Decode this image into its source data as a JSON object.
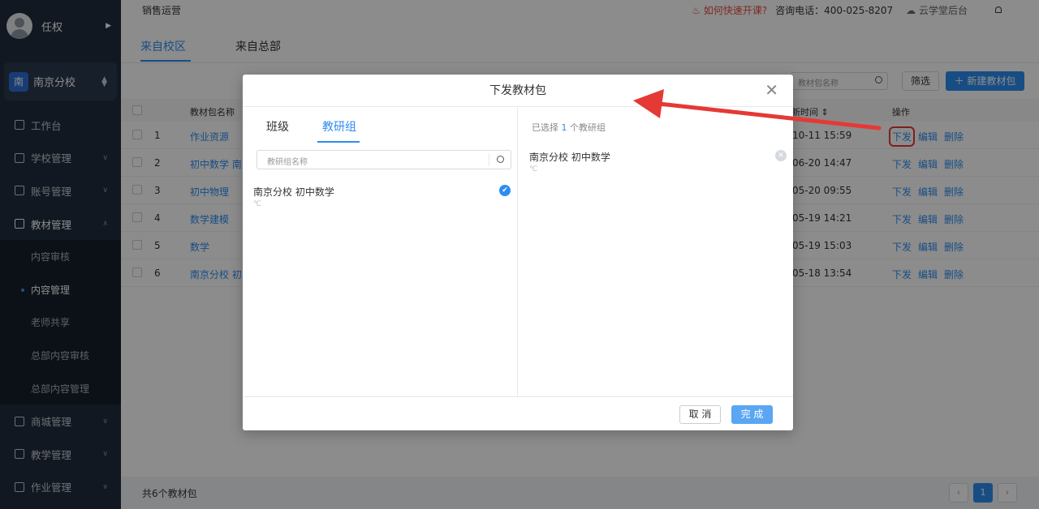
{
  "sidebar": {
    "user_name": "任权",
    "branch_badge": "南",
    "branch_name": "南京分校",
    "items": [
      {
        "label": "工作台"
      },
      {
        "label": "学校管理"
      },
      {
        "label": "账号管理"
      },
      {
        "label": "教材管理"
      },
      {
        "label": "商城管理"
      },
      {
        "label": "教学管理"
      },
      {
        "label": "作业管理"
      }
    ],
    "sub_items": [
      {
        "label": "内容审核"
      },
      {
        "label": "内容管理"
      },
      {
        "label": "老师共享"
      },
      {
        "label": "总部内容审核"
      },
      {
        "label": "总部内容管理"
      }
    ]
  },
  "topbar": {
    "breadcrumb": "销售运营",
    "help_link": "如何快速开课?",
    "phone": "咨询电话：400-025-8207",
    "cloud": "云学堂后台"
  },
  "tabs": [
    "来自校区",
    "来自总部"
  ],
  "toolbar": {
    "search_placeholder": "教材包名称",
    "filter_label": "筛选",
    "new_label": "＋ 新建教材包"
  },
  "table": {
    "headers": {
      "name": "教材包名称",
      "time": "更新时间 ⇕",
      "ops": "操作"
    },
    "rows": [
      {
        "index": "1",
        "name": "作业资源",
        "time": "2-10-11 15:59"
      },
      {
        "index": "2",
        "name": "初中数学 南",
        "time": "2-06-20 14:47"
      },
      {
        "index": "3",
        "name": "初中物理",
        "time": "2-05-20 09:55"
      },
      {
        "index": "4",
        "name": "数学建模",
        "time": "2-05-19 14:21"
      },
      {
        "index": "5",
        "name": "数学",
        "time": "2-05-19 15:03"
      },
      {
        "index": "6",
        "name": "南京分校 初",
        "time": "2-05-18 13:54"
      }
    ],
    "actions": {
      "distribute": "下发",
      "edit": "编辑",
      "delete": "删除"
    }
  },
  "footer": {
    "total": "共6个教材包",
    "page": "1"
  },
  "modal": {
    "title": "下发教材包",
    "tabs": [
      "班级",
      "教研组"
    ],
    "search_placeholder": "教研组名称",
    "option": {
      "name": "南京分校 初中数学",
      "sub": "℃"
    },
    "selected_prefix": "已选择",
    "selected_count": "1",
    "selected_suffix": "个教研组",
    "selected": {
      "name": "南京分校 初中数学",
      "sub": "℃"
    },
    "cancel_label": "取 消",
    "done_label": "完 成"
  },
  "colors": {
    "accent": "#2d8cf0",
    "sidebar": "#1f2d3d",
    "annotation": "#e53935"
  }
}
